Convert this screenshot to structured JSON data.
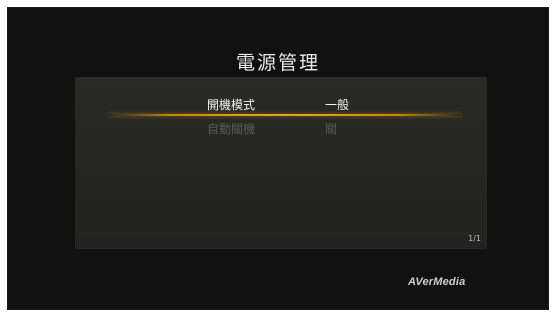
{
  "screen": {
    "title": "電源管理"
  },
  "menu": {
    "items": [
      {
        "label": "開機模式",
        "value": "一般"
      },
      {
        "label": "自動關機",
        "value": "關"
      }
    ],
    "page_indicator": "1/1"
  },
  "brand": {
    "logo_text": "AVerMedia"
  },
  "colors": {
    "background": "#111111",
    "panel": "#262622",
    "highlight": "#cc8800",
    "text": "#f2f2f2",
    "text_dim": "#5a5a52"
  }
}
